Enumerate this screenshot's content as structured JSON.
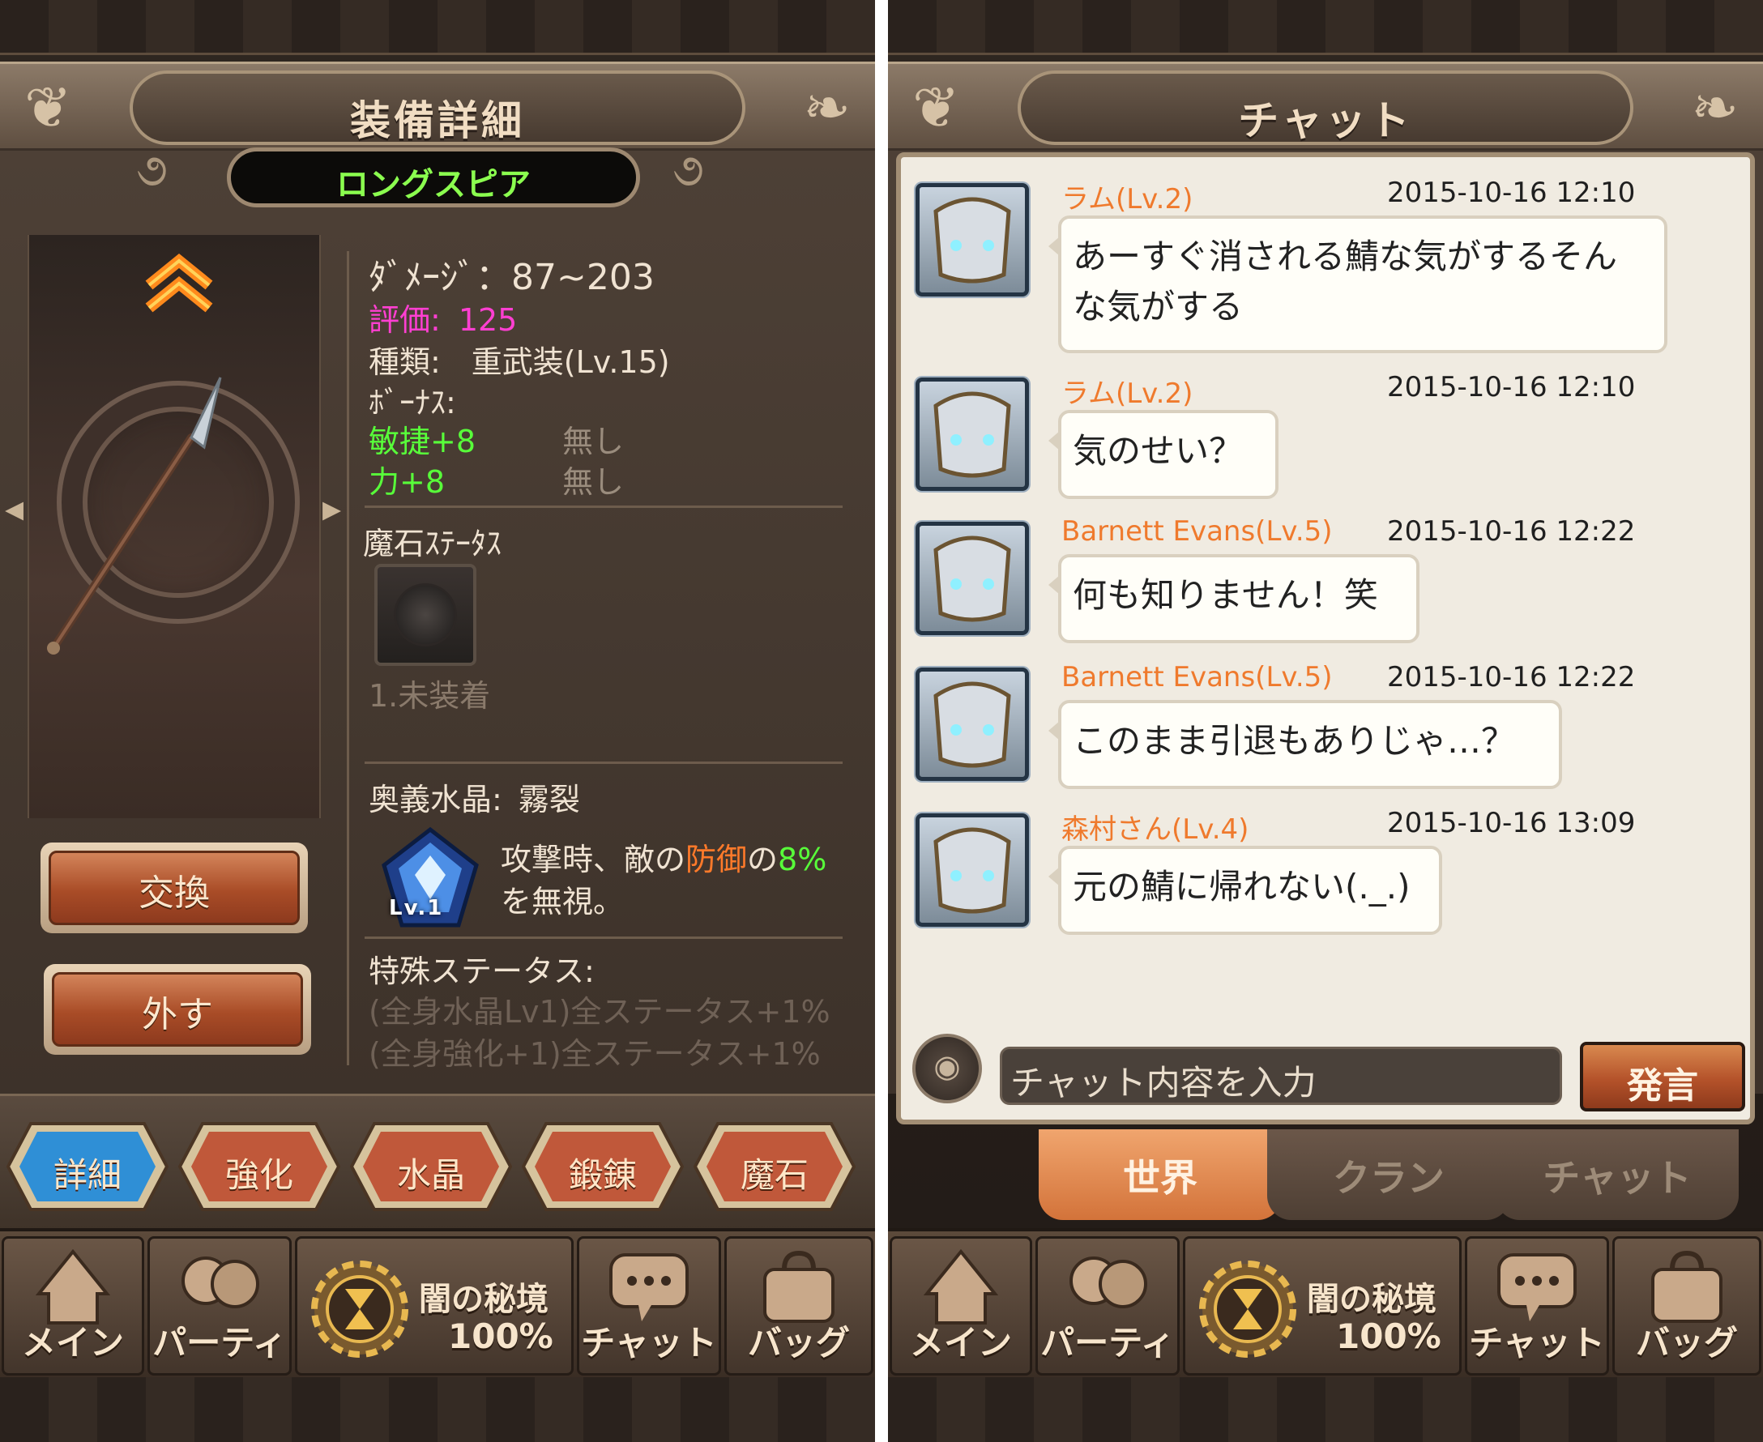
{
  "equip": {
    "title": "装備詳細",
    "item_name": "ロングスピア",
    "damage": "ﾀﾞﾒｰｼﾞ：87~203",
    "rating_label": "評価:",
    "rating_value": "125",
    "type_line": "種類:　重武装(Lv.15)",
    "bonus_label": "ﾎﾞｰﾅｽ:",
    "bonuses": [
      {
        "stat": "敏捷+8",
        "note": "無し"
      },
      {
        "stat": "力+8",
        "note": "無し"
      }
    ],
    "magic_stone_label": "魔石ｽﾃｰﾀｽ",
    "magic_stone_slot": "1.未装着",
    "secret_crystal_label": "奥義水晶:",
    "secret_crystal_value": "霧裂",
    "crystal_level": "Lv.1",
    "crystal_desc_1": "攻撃時、敵の",
    "crystal_desc_def": "防御",
    "crystal_desc_no": "の",
    "crystal_desc_pct": "8%",
    "crystal_desc_2": "を無視。",
    "special_label": "特殊ステータス:",
    "special_lines": [
      "(全身水晶Lv1)全ステータス+1%",
      "(全身強化+1)全ステータス+1%"
    ],
    "exchange_button": "交換",
    "remove_button": "外す",
    "tabs": [
      "詳細",
      "強化",
      "水晶",
      "鍛錬",
      "魔石"
    ],
    "colors": {
      "pink": "#ff3fd2",
      "green": "#58ff3a",
      "active_tab": "#2f8fd6",
      "inactive_tab": "#c0583a"
    }
  },
  "nav": {
    "main": "メイン",
    "party": "パーティ",
    "dungeon_title": "闇の秘境",
    "dungeon_pct": "100%",
    "chat": "チャット",
    "bag": "バッグ"
  },
  "chat": {
    "title": "チャット",
    "messages": [
      {
        "name": "ラム(Lv.2)",
        "time": "2015-10-16 12:10",
        "line1": "あーすぐ消される鯖な気がするそん",
        "line2": "な気がする"
      },
      {
        "name": "ラム(Lv.2)",
        "time": "2015-10-16 12:10",
        "line1": "気のせい？"
      },
      {
        "name": "Barnett Evans(Lv.5)",
        "time": "2015-10-16 12:22",
        "line1": "何も知りません！笑"
      },
      {
        "name": "Barnett Evans(Lv.5)",
        "time": "2015-10-16 12:22",
        "line1": "このまま引退もありじゃ…？"
      },
      {
        "name": "森村さん(Lv.4)",
        "time": "2015-10-16 13:09",
        "line1": "元の鯖に帰れない(._.)"
      }
    ],
    "input_placeholder": "チャット内容を入力",
    "send_button": "発言",
    "tabs": [
      "世界",
      "クラン",
      "チャット"
    ],
    "colors": {
      "name": "#ef7a2d",
      "active_tab": "#e08a4e"
    }
  }
}
